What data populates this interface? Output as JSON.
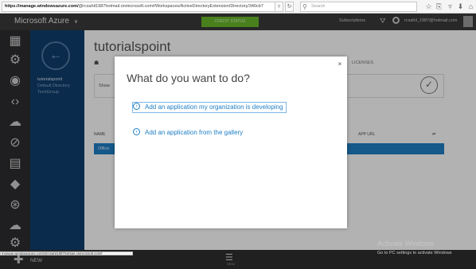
{
  "browser": {
    "url_host": "https://manage.windowsazure.com/",
    "url_rest": "@rcsahil1987hotmail.onmicrosoft.com#Workspaces/ActiveDirectoryExtension/Directory/340cb7",
    "search_placeholder": "Search"
  },
  "portal": {
    "brand": "Microsoft Azure",
    "credit_button": "CREDIT STATUS",
    "subscriptions": "Subscriptions",
    "user": "rcsahil_1987@hotmail.com",
    "page_title": "tutorialspoint",
    "tab_right": "LICENSES",
    "show_label": "Show",
    "table_name_header": "NAME",
    "table_app_header": "APP URL",
    "table_row": "Office",
    "subnav": [
      "tutorialspoint",
      "Default Directory",
      "TechGroup"
    ],
    "new_label": "NEW",
    "menu_label": "MENU"
  },
  "dialog": {
    "title": "What do you want to do?",
    "options": [
      "Add an application my organization is developing",
      "Add an application from the gallery"
    ],
    "close": "×"
  },
  "status_url": "manage.windowsazure.com/@rcsahil1987hotmail.onmicrosoft.com#",
  "watermark": {
    "title": "Activate Windows",
    "subtitle": "Go to PC settings to activate Windows"
  }
}
